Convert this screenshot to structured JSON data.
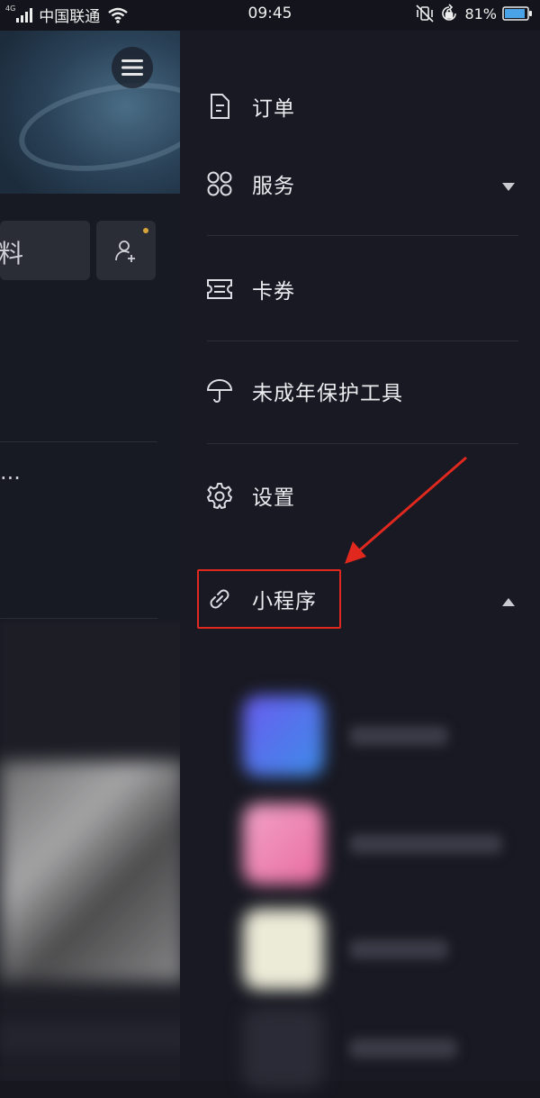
{
  "status_bar": {
    "network_badge": "4G",
    "carrier": "中国联通",
    "time": "09:45",
    "battery_percent": "81%",
    "icons": [
      "signal-icon",
      "wifi-icon",
      "vibrate-off-icon",
      "rotation-lock-icon",
      "battery-icon"
    ]
  },
  "background_app": {
    "menu_icon": "hamburger-menu-icon",
    "tile_text": "料",
    "ellipsis": "...",
    "add_friend_icon": "add-user-icon",
    "badge_color": "#d7a43a"
  },
  "drawer": {
    "items": [
      {
        "label": "订单",
        "icon": "order-document-icon",
        "caret": null
      },
      {
        "label": "服务",
        "icon": "grid-services-icon",
        "caret": "down"
      },
      {
        "label": "卡券",
        "icon": "coupon-ticket-icon",
        "caret": null
      },
      {
        "label": "未成年保护工具",
        "icon": "umbrella-icon",
        "caret": null
      },
      {
        "label": "设置",
        "icon": "gear-icon",
        "caret": null
      },
      {
        "label": "小程序",
        "icon": "link-icon",
        "caret": "up"
      }
    ],
    "mini_programs_count": 4
  },
  "annotation": {
    "highlight_color": "#e0281e",
    "arrow_color": "#e0281e",
    "target": "小程序"
  }
}
